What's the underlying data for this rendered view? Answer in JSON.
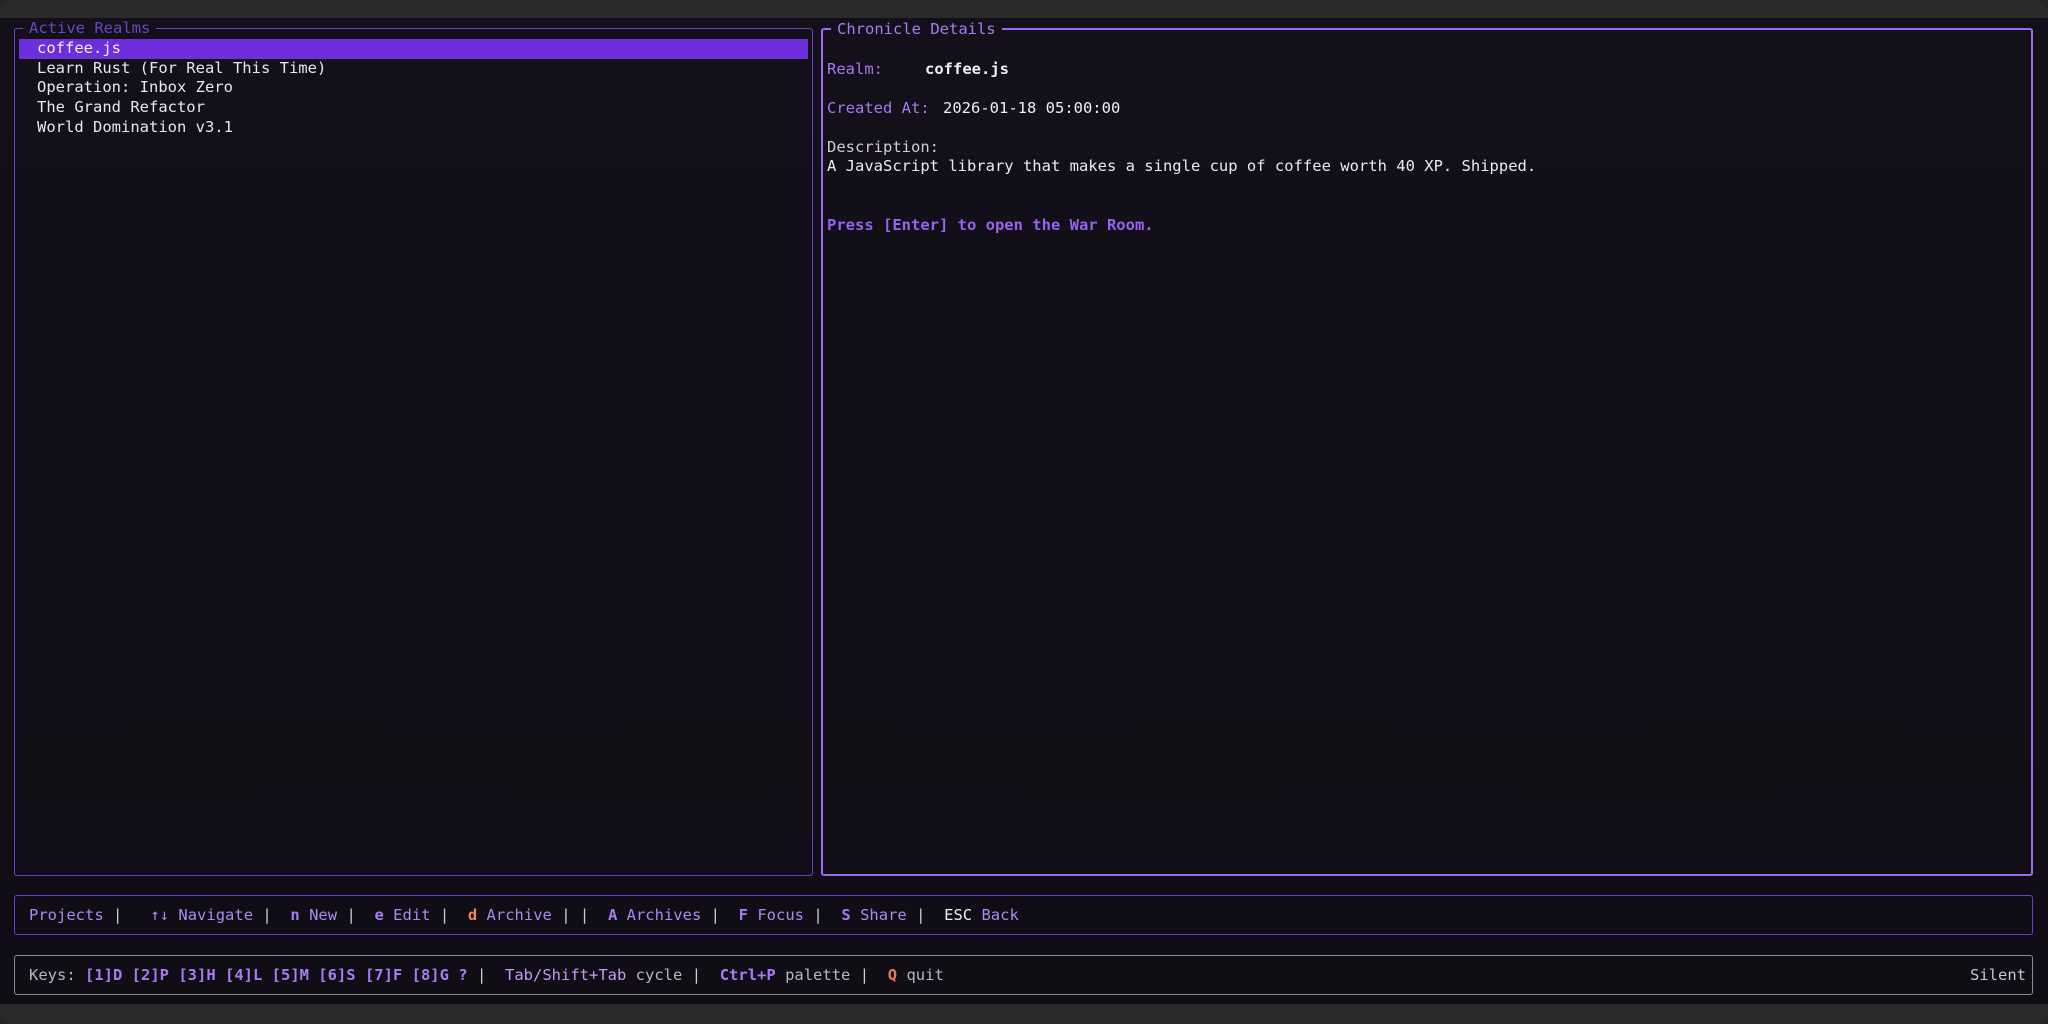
{
  "left_panel": {
    "title": "Active Realms",
    "items": [
      {
        "label": "coffee.js",
        "selected": true
      },
      {
        "label": "Learn Rust (For Real This Time)",
        "selected": false
      },
      {
        "label": "Operation: Inbox Zero",
        "selected": false
      },
      {
        "label": "The Grand Refactor",
        "selected": false
      },
      {
        "label": "World Domination v3.1",
        "selected": false
      }
    ]
  },
  "right_panel": {
    "title": "Chronicle Details",
    "realm_label": "Realm:",
    "realm_value": "coffee.js",
    "created_label": "Created At:",
    "created_value": "2026-01-18 05:00:00",
    "description_label": "Description:",
    "description_text": "A JavaScript library that makes a single cup of coffee worth 40 XP. Shipped.",
    "enter_hint": "Press [Enter] to open the War Room."
  },
  "command_bar": {
    "context": "Projects",
    "sep": "|",
    "navigate_key": "↑↓",
    "navigate_label": "Navigate",
    "new_key": "n",
    "new_label": "New",
    "edit_key": "e",
    "edit_label": "Edit",
    "archive_key": "d",
    "archive_label": "Archive",
    "archives_key": "A",
    "archives_label": "Archives",
    "focus_key": "F",
    "focus_label": "Focus",
    "share_key": "S",
    "share_label": "Share",
    "back_key": "ESC",
    "back_label": "Back"
  },
  "keys_bar": {
    "prefix": "Keys:",
    "view_keys": "[1]D [2]P [3]H [4]L [5]M [6]S [7]F [8]G ?",
    "cycle_key": "Tab/Shift+Tab",
    "cycle_label": "cycle",
    "palette_key": "Ctrl+P",
    "palette_label": "palette",
    "quit_key": "Q",
    "quit_label": "quit",
    "status": "Silent"
  },
  "colors": {
    "selection": "#6d2fdc",
    "accent": "#a06af0",
    "warning": "#f08a5a"
  }
}
